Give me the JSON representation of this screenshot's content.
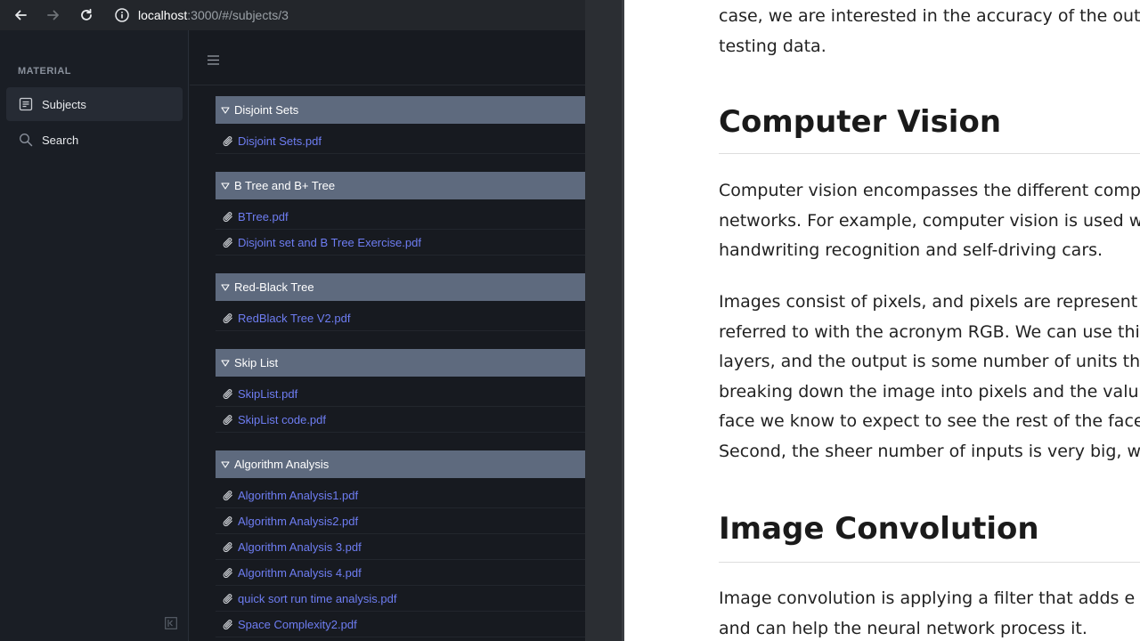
{
  "browser": {
    "url_host": "localhost",
    "url_path": ":3000/#/subjects/3"
  },
  "sidebar": {
    "heading": "MATERIAL",
    "items": [
      {
        "label": "Subjects",
        "icon": "document-list-icon",
        "active": true
      },
      {
        "label": "Search",
        "icon": "search-icon",
        "active": false
      }
    ]
  },
  "sections": [
    {
      "title": "Disjoint Sets",
      "files": [
        "Disjoint Sets.pdf"
      ]
    },
    {
      "title": "B Tree and B+ Tree",
      "files": [
        "BTree.pdf",
        "Disjoint set and B Tree Exercise.pdf"
      ]
    },
    {
      "title": "Red-Black Tree",
      "files": [
        "RedBlack Tree V2.pdf"
      ]
    },
    {
      "title": "Skip List",
      "files": [
        "SkipList.pdf",
        "SkipList code.pdf"
      ]
    },
    {
      "title": "Algorithm Analysis",
      "files": [
        "Algorithm Analysis1.pdf",
        "Algorithm Analysis2.pdf",
        "Algorithm Analysis 3.pdf",
        "Algorithm Analysis 4.pdf",
        "quick sort run time analysis.pdf",
        "Space Complexity2.pdf"
      ]
    }
  ],
  "document": {
    "intro_lines": [
      "case, we are interested in the accuracy of the outp",
      "testing data."
    ],
    "heading1": "Computer Vision",
    "para1_lines": [
      "Computer vision encompasses the different comp",
      "networks. For example, computer vision is used w",
      "handwriting recognition and self-driving cars."
    ],
    "para2_lines": [
      "Images consist of pixels, and pixels are represent",
      "referred to with the acronym RGB. We can use thi",
      "layers, and the output is some number of units th",
      "breaking down the image into pixels and the valu",
      "face we know to expect to see the rest of the face",
      "Second, the sheer number of inputs is very big, wh"
    ],
    "heading2": "Image Convolution",
    "para3_lines": [
      "Image convolution is applying a filter that adds e",
      "and can help the neural network process it."
    ]
  },
  "colors": {
    "link": "#6e7df2",
    "section_header_bg": "#5e6a7e",
    "sidebar_bg": "#1a1e25",
    "doc_bg": "#ffffff"
  }
}
